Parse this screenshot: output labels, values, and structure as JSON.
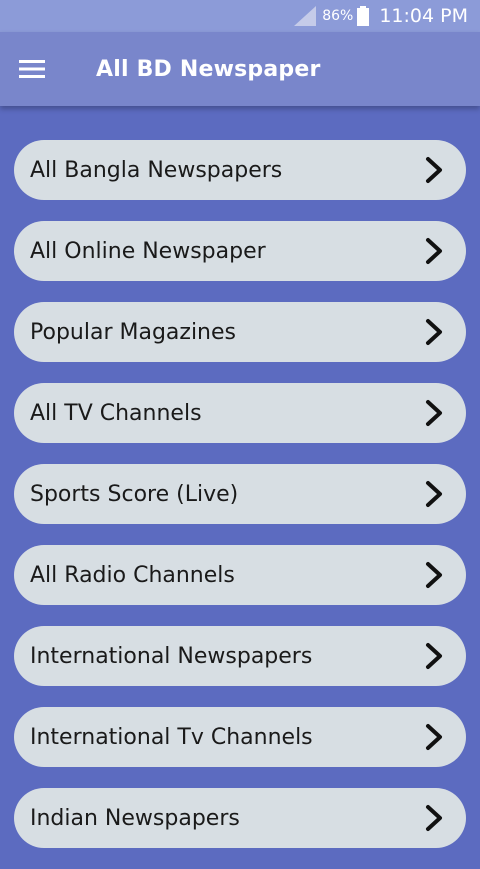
{
  "status_bar": {
    "battery_percent": "86%",
    "time": "11:04 PM",
    "icons": [
      "signal-icon",
      "battery-icon"
    ]
  },
  "app_bar": {
    "title": "All BD Newspaper",
    "menu_icon": "hamburger-menu-icon"
  },
  "menu": {
    "items": [
      {
        "label": "All Bangla Newspapers",
        "icon": "chevron-right-icon"
      },
      {
        "label": "All Online Newspaper",
        "icon": "chevron-right-icon"
      },
      {
        "label": "Popular Magazines",
        "icon": "chevron-right-icon"
      },
      {
        "label": "All TV Channels",
        "icon": "chevron-right-icon"
      },
      {
        "label": "Sports Score (Live)",
        "icon": "chevron-right-icon"
      },
      {
        "label": "All Radio Channels",
        "icon": "chevron-right-icon"
      },
      {
        "label": "International Newspapers",
        "icon": "chevron-right-icon"
      },
      {
        "label": "International Tv Channels",
        "icon": "chevron-right-icon"
      },
      {
        "label": "Indian Newspapers",
        "icon": "chevron-right-icon"
      }
    ]
  },
  "colors": {
    "background": "#5C6BC0",
    "app_bar": "#7986CB",
    "status_bar": "#8C9BD8",
    "item_background": "#D7DEE3",
    "item_text": "#1a1a1a"
  }
}
